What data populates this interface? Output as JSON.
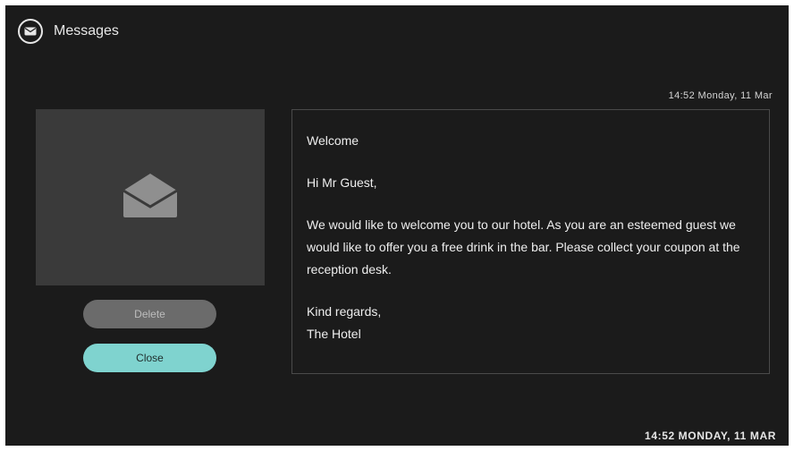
{
  "header": {
    "title": "Messages",
    "icon": "message-envelope-icon"
  },
  "message": {
    "timestamp": "14:52 Monday, 11 Mar",
    "subject": "Welcome",
    "greeting": "Hi Mr Guest,",
    "body": "We would like to welcome you to our hotel. As you are an esteemed guest we would like to offer you a free drink in the bar. Please collect your coupon at the reception desk.",
    "closing": "Kind regards,",
    "signature": "The Hotel",
    "preview_icon": "open-envelope-icon"
  },
  "actions": {
    "delete_label": "Delete",
    "close_label": "Close"
  },
  "footer": {
    "clock": "14:52 MONDAY, 11 MAR"
  },
  "colors": {
    "background": "#1b1b1b",
    "preview_panel": "#3a3a3a",
    "delete_button": "#6b6b6b",
    "close_button": "#7fd3cf"
  }
}
